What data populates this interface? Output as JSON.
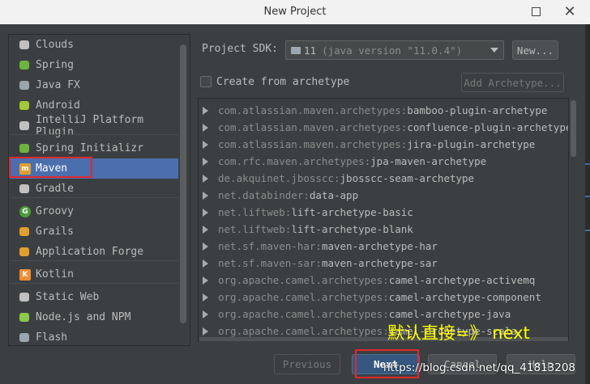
{
  "window": {
    "title": "New Project"
  },
  "sidebar": {
    "items": [
      {
        "label": "Clouds",
        "icon": "clouds-icon",
        "glyph": "",
        "color": "#c0c0c0"
      },
      {
        "label": "Spring",
        "icon": "spring-icon",
        "glyph": "",
        "color": "#6db33f"
      },
      {
        "label": "Java FX",
        "icon": "javafx-folder-icon",
        "glyph": "",
        "color": "#9aa7b0"
      },
      {
        "label": "Android",
        "icon": "android-icon",
        "glyph": "",
        "color": "#a4c639"
      },
      {
        "label": "IntelliJ Platform Plugin",
        "icon": "plugin-icon",
        "glyph": "",
        "color": "#c0c0c0"
      },
      {
        "label": "Spring Initializr",
        "icon": "spring-initializr-icon",
        "glyph": "",
        "color": "#6db33f"
      },
      {
        "label": "Maven",
        "icon": "maven-icon",
        "glyph": "m",
        "color": "#e0a030"
      },
      {
        "label": "Gradle",
        "icon": "gradle-icon",
        "glyph": "",
        "color": "#c0c0c0"
      },
      {
        "label": "Groovy",
        "icon": "groovy-icon",
        "glyph": "G",
        "color": "#4c9e3a"
      },
      {
        "label": "Grails",
        "icon": "grails-icon",
        "glyph": "",
        "color": "#e0a030"
      },
      {
        "label": "Application Forge",
        "icon": "application-forge-icon",
        "glyph": "",
        "color": "#e0a030"
      },
      {
        "label": "Kotlin",
        "icon": "kotlin-icon",
        "glyph": "K",
        "color": "#f18e33"
      },
      {
        "label": "Static Web",
        "icon": "static-web-icon",
        "glyph": "",
        "color": "#c0c0c0"
      },
      {
        "label": "Node.js and NPM",
        "icon": "nodejs-icon",
        "glyph": "",
        "color": "#8cc84b"
      },
      {
        "label": "Flash",
        "icon": "flash-folder-icon",
        "glyph": "",
        "color": "#9aa7b0"
      }
    ],
    "selected": "Maven"
  },
  "sdk": {
    "label": "Project SDK:",
    "value_num": "11",
    "value_detail": "(java version \"11.0.4\")",
    "new_button": "New..."
  },
  "archetype": {
    "checkbox_label": "Create from archetype",
    "checked": false,
    "add_button": "Add Archetype..."
  },
  "archetypes": [
    {
      "group": "com.atlassian.maven.archetypes:",
      "artifact": "bamboo-plugin-archetype"
    },
    {
      "group": "com.atlassian.maven.archetypes:",
      "artifact": "confluence-plugin-archetype"
    },
    {
      "group": "com.atlassian.maven.archetypes:",
      "artifact": "jira-plugin-archetype"
    },
    {
      "group": "com.rfc.maven.archetypes:",
      "artifact": "jpa-maven-archetype"
    },
    {
      "group": "de.akquinet.jbosscc:",
      "artifact": "jbosscc-seam-archetype"
    },
    {
      "group": "net.databinder:",
      "artifact": "data-app"
    },
    {
      "group": "net.liftweb:",
      "artifact": "lift-archetype-basic"
    },
    {
      "group": "net.liftweb:",
      "artifact": "lift-archetype-blank"
    },
    {
      "group": "net.sf.maven-har:",
      "artifact": "maven-archetype-har"
    },
    {
      "group": "net.sf.maven-sar:",
      "artifact": "maven-archetype-sar"
    },
    {
      "group": "org.apache.camel.archetypes:",
      "artifact": "camel-archetype-activemq"
    },
    {
      "group": "org.apache.camel.archetypes:",
      "artifact": "camel-archetype-component"
    },
    {
      "group": "org.apache.camel.archetypes:",
      "artifact": "camel-archetype-java"
    },
    {
      "group": "org.apache.camel.archetypes:",
      "artifact": "camel-archetype-scala"
    }
  ],
  "footer": {
    "previous": "Previous",
    "next": "Next",
    "cancel": "Cancel",
    "help": "Help"
  },
  "overlay": {
    "annotation": "默认直接=》 next",
    "watermark": "https://blog.csdn.net/qq_41813208"
  },
  "colors": {
    "background": "#3c3f41",
    "selection": "#4b6eaf",
    "highlight": "#e0292e",
    "annotation": "#ffff00",
    "default_button": "#365880"
  }
}
